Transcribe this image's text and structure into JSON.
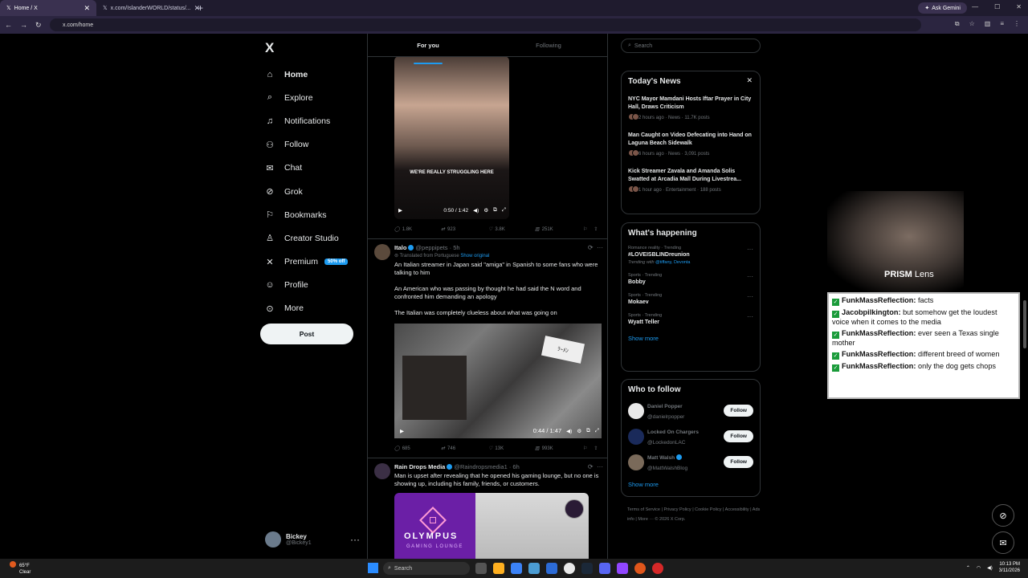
{
  "browser": {
    "tabs": [
      {
        "title": "Home / X",
        "active": true
      },
      {
        "title": "x.com/IslanderWORLD/status/...",
        "active": false
      }
    ],
    "ask_gemini": "Ask Gemini",
    "url": "x.com/home"
  },
  "nav": {
    "logo": "X",
    "items": [
      {
        "label": "Home",
        "icon": "home-icon",
        "glyph": "⌂"
      },
      {
        "label": "Explore",
        "icon": "search-icon",
        "glyph": "⌕"
      },
      {
        "label": "Notifications",
        "icon": "bell-icon",
        "glyph": "♫"
      },
      {
        "label": "Follow",
        "icon": "follow-icon",
        "glyph": "⚇"
      },
      {
        "label": "Chat",
        "icon": "mail-icon",
        "glyph": "✉"
      },
      {
        "label": "Grok",
        "icon": "grok-icon",
        "glyph": "⊘"
      },
      {
        "label": "Bookmarks",
        "icon": "bookmark-icon",
        "glyph": "⚐"
      },
      {
        "label": "Creator Studio",
        "icon": "creator-icon",
        "glyph": "♙"
      },
      {
        "label": "Premium",
        "icon": "x-icon",
        "glyph": "✕"
      },
      {
        "label": "Profile",
        "icon": "profile-icon",
        "glyph": "☺"
      },
      {
        "label": "More",
        "icon": "more-icon",
        "glyph": "⊙"
      }
    ],
    "premium_badge": "50% off",
    "post_label": "Post",
    "account": {
      "name": "Bickey",
      "handle": "@Bickey1"
    }
  },
  "feed": {
    "tabs": [
      "For you",
      "Following"
    ],
    "post1": {
      "caption": "WE'RE REALLY STRUGGLING HERE",
      "time": "0:50 / 1:42",
      "stats": [
        "1.8K",
        "923",
        "3.8K",
        "251K"
      ]
    },
    "post2": {
      "name": "Italo",
      "handle": "@peppipets · 5h",
      "translated": "Translated from Portuguese",
      "show_original": "Show original",
      "paragraphs": [
        "An Italian streamer in Japan said \"amiga\" in Spanish to some fans who were talking to him",
        "An American who was passing by thought he had said the N word and confronted him demanding an apology",
        "The Italian was completely clueless about what was going on"
      ],
      "time": "0:44 / 1:47",
      "stats": [
        "685",
        "746",
        "13K",
        "993K"
      ]
    },
    "post3": {
      "name": "Rain Drops Media",
      "handle": "@Raindropsmedia1 · 6h",
      "text": "Man is upset after revealing that he opened his gaming lounge, but no one is showing up, including his family, friends, or customers.",
      "brand": "OLYMPUS",
      "brand_sub": "GAMING LOUNGE"
    }
  },
  "right": {
    "search_placeholder": "Search",
    "todays_news": {
      "title": "Today's News",
      "items": [
        {
          "title": "NYC Mayor Mamdani Hosts Iftar Prayer in City Hall, Draws Criticism",
          "meta": "2 hours ago · News · 11.7K posts"
        },
        {
          "title": "Man Caught on Video Defecating into Hand on Laguna Beach Sidewalk",
          "meta": "6 hours ago · News · 3,091 posts"
        },
        {
          "title": "Kick Streamer Zavala and Amanda Solis Swatted at Arcadia Mall During Livestrea...",
          "meta": "1 hour ago · Entertainment · 188 posts"
        }
      ]
    },
    "happening": {
      "title": "What's happening",
      "trends": [
        {
          "context": "Romance reality · Trending",
          "name": "#LOVEISBLINDreunion",
          "with_label": "Trending with",
          "with": "@tiffany, Devonta"
        },
        {
          "context": "Sports · Trending",
          "name": "Bobby"
        },
        {
          "context": "Sports · Trending",
          "name": "Mokaev"
        },
        {
          "context": "Sports · Trending",
          "name": "Wyatt Teller"
        }
      ],
      "show_more": "Show more"
    },
    "who_to_follow": {
      "title": "Who to follow",
      "accounts": [
        {
          "name": "Daniel Popper",
          "handle": "@danielrpopper",
          "verified": false
        },
        {
          "name": "Locked On Chargers",
          "handle": "@LockedonLAC",
          "verified": false
        },
        {
          "name": "Matt Walsh",
          "handle": "@MattWalshBlog",
          "verified": true
        }
      ],
      "follow_label": "Follow",
      "show_more": "Show more"
    },
    "footer": "Terms of Service | Privacy Policy | Cookie Policy | Accessibility | Ads info | More ··· © 2026 X Corp."
  },
  "overlay": {
    "lens_brand": "PRISM",
    "lens_suffix": "Lens",
    "chat": [
      {
        "user": "FunkMassReflection:",
        "msg": "facts"
      },
      {
        "user": "Jacobpilkington:",
        "msg": "but somehow get the loudest voice when it comes to the media"
      },
      {
        "user": "FunkMassReflection:",
        "msg": "ever seen a Texas single mother"
      },
      {
        "user": "FunkMassReflection:",
        "msg": "different breed of women"
      },
      {
        "user": "FunkMassReflection:",
        "msg": "only the dog gets chops"
      }
    ]
  },
  "taskbar": {
    "temp": "65°F",
    "weather": "Clear",
    "search": "Search",
    "time": "10:13 PM",
    "date": "3/11/2026"
  }
}
